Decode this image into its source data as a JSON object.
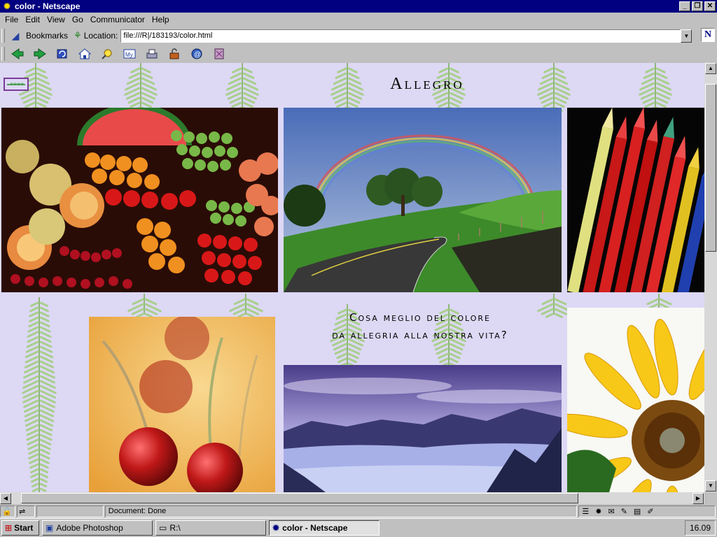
{
  "window": {
    "title": "color - Netscape",
    "controls": [
      "_",
      "❐",
      "✕"
    ]
  },
  "menu": {
    "items": [
      "File",
      "Edit",
      "View",
      "Go",
      "Communicator",
      "Help"
    ]
  },
  "nav": {
    "bookmarks_label": "Bookmarks",
    "location_label": "Location:",
    "url": "file:///R|/183193/color.html"
  },
  "toolbar": {
    "icons": [
      "back-icon",
      "forward-icon",
      "reload-icon",
      "home-icon",
      "search-icon",
      "my-netscape-icon",
      "print-icon",
      "security-icon",
      "shop-icon",
      "stop-icon"
    ]
  },
  "page": {
    "title": "Allegro",
    "message_line1": "Cosa meglio del colore",
    "message_line2": "da allegria alla nostra vita?",
    "background_color": "#ddd8f4"
  },
  "status": {
    "text": "Document: Done"
  },
  "taskbar": {
    "start_label": "Start",
    "tasks": [
      {
        "label": "Adobe Photoshop",
        "active": false
      },
      {
        "label": "R:\\",
        "active": false
      },
      {
        "label": "color - Netscape",
        "active": true
      }
    ],
    "clock": "16.09"
  }
}
